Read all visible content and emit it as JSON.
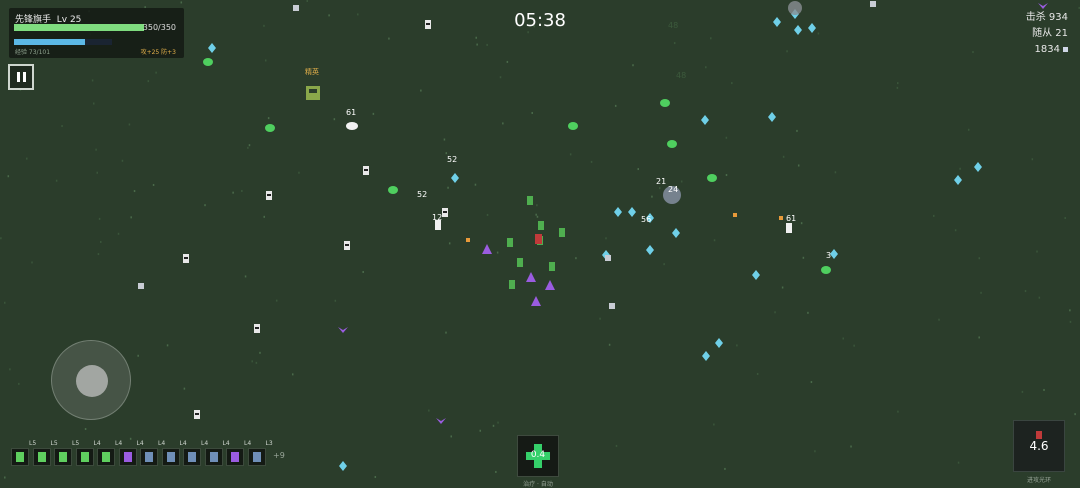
{
  "hud": {
    "name": "先锋旗手",
    "level": "Lv 25",
    "hp_text": "350/350",
    "hp_fraction": 1.0,
    "xp_text": "经验 73/101",
    "xp_fraction": 0.72,
    "buff_text": "攻+25 防+3"
  },
  "timer": "05:38",
  "stats": {
    "kills": "击杀 934",
    "followers": "随从 21",
    "gems": "1834"
  },
  "world": {
    "elite_label": "精英",
    "damage_numbers": [
      "61",
      "52",
      "12",
      "52",
      "21",
      "24",
      "56",
      "61",
      "48",
      "48",
      "3"
    ]
  },
  "follower_bar": {
    "slots": [
      {
        "level": "L5",
        "kind": "green"
      },
      {
        "level": "L5",
        "kind": "green"
      },
      {
        "level": "L5",
        "kind": "green"
      },
      {
        "level": "L4",
        "kind": "green"
      },
      {
        "level": "L4",
        "kind": "green"
      },
      {
        "level": "L4",
        "kind": "purple"
      },
      {
        "level": "L4",
        "kind": "blue"
      },
      {
        "level": "L4",
        "kind": "blue"
      },
      {
        "level": "L4",
        "kind": "blue"
      },
      {
        "level": "L4",
        "kind": "blue"
      },
      {
        "level": "L4",
        "kind": "purple"
      },
      {
        "level": "L3",
        "kind": "blue"
      }
    ],
    "more": "+9"
  },
  "heal": {
    "cooldown": "0.4",
    "label": "治疗 · 自动"
  },
  "skill": {
    "cooldown": "4.6",
    "label": "进攻光环"
  },
  "colors": {
    "background": "#2b3d2b",
    "hp": "#7fdc7f",
    "xp": "#5cb8e6",
    "buff": "#e3b04a",
    "heal": "#35d06a"
  }
}
